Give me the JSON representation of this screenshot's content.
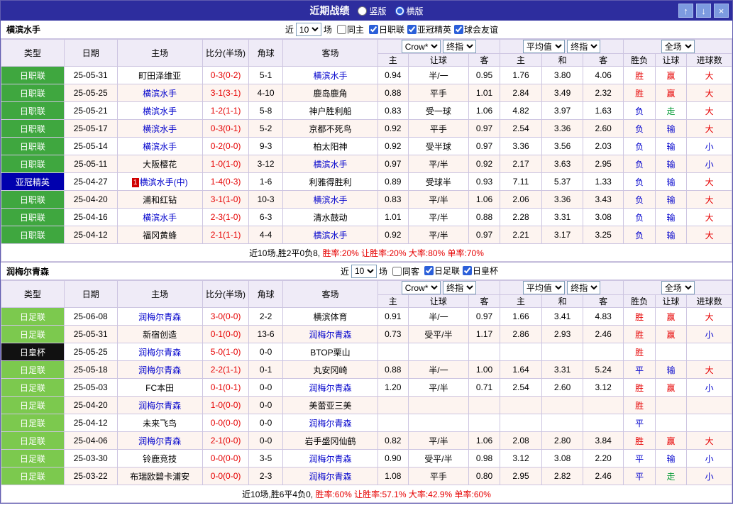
{
  "titlebar": {
    "title": "近期战绩",
    "vertical_label": "竖版",
    "horizontal_label": "横版",
    "icons": {
      "up": "↑",
      "down": "↓",
      "close": "×"
    }
  },
  "colors": {
    "titlebar_bg": "#2d2d9e",
    "header_bg": "#efebf7",
    "league_green": "#3fa73f",
    "league_lightgreen": "#7cc94e",
    "league_blue": "#0000ae",
    "league_black": "#111111",
    "win_red": "#e60000",
    "lose_blue": "#0000cc",
    "push_green": "#009933"
  },
  "sections": [
    {
      "team": "横滨水手",
      "filter": {
        "near_label": "近",
        "count": "10",
        "games_label": "场",
        "same": {
          "label": "同主",
          "checked": false
        },
        "leagues": [
          {
            "label": "日职联",
            "checked": true
          },
          {
            "label": "亚冠精英",
            "checked": true
          },
          {
            "label": "球会友谊",
            "checked": true
          }
        ]
      },
      "header": {
        "cols": [
          "类型",
          "日期",
          "主场",
          "比分(半场)",
          "角球",
          "客场"
        ],
        "selects": [
          "Crow*",
          "终指",
          "平均值",
          "终指",
          "全场"
        ],
        "sub": [
          "主",
          "让球",
          "客",
          "主",
          "和",
          "客",
          "胜负",
          "让球",
          "进球数"
        ]
      },
      "rows": [
        {
          "league": "日职联",
          "lg": "green",
          "date": "25-05-31",
          "badge": "",
          "home": "町田泽维亚",
          "home_link": false,
          "score": "0-3(0-2)",
          "corner": "5-1",
          "away": "横滨水手",
          "away_link": true,
          "odds": [
            "0.94",
            "半/一",
            "0.95"
          ],
          "euro": [
            "1.76",
            "3.80",
            "4.06"
          ],
          "result": [
            "胜",
            "r"
          ],
          "handicap_result": [
            "赢",
            "r"
          ],
          "goal_result": [
            "大",
            "r"
          ]
        },
        {
          "league": "日职联",
          "lg": "green",
          "date": "25-05-25",
          "badge": "",
          "home": "横滨水手",
          "home_link": true,
          "score": "3-1(3-1)",
          "corner": "4-10",
          "away": "鹿岛鹿角",
          "away_link": false,
          "odds": [
            "0.88",
            "平手",
            "1.01"
          ],
          "euro": [
            "2.84",
            "3.49",
            "2.32"
          ],
          "result": [
            "胜",
            "r"
          ],
          "handicap_result": [
            "赢",
            "r"
          ],
          "goal_result": [
            "大",
            "r"
          ]
        },
        {
          "league": "日职联",
          "lg": "green",
          "date": "25-05-21",
          "badge": "",
          "home": "横滨水手",
          "home_link": true,
          "score": "1-2(1-1)",
          "corner": "5-8",
          "away": "神户胜利船",
          "away_link": false,
          "odds": [
            "0.83",
            "受一球",
            "1.06"
          ],
          "euro": [
            "4.82",
            "3.97",
            "1.63"
          ],
          "result": [
            "负",
            "b"
          ],
          "handicap_result": [
            "走",
            "g"
          ],
          "goal_result": [
            "大",
            "r"
          ]
        },
        {
          "league": "日职联",
          "lg": "green",
          "date": "25-05-17",
          "badge": "",
          "home": "横滨水手",
          "home_link": true,
          "score": "0-3(0-1)",
          "corner": "5-2",
          "away": "京都不死鸟",
          "away_link": false,
          "odds": [
            "0.92",
            "平手",
            "0.97"
          ],
          "euro": [
            "2.54",
            "3.36",
            "2.60"
          ],
          "result": [
            "负",
            "b"
          ],
          "handicap_result": [
            "输",
            "b"
          ],
          "goal_result": [
            "大",
            "r"
          ]
        },
        {
          "league": "日职联",
          "lg": "green",
          "date": "25-05-14",
          "badge": "",
          "home": "横滨水手",
          "home_link": true,
          "score": "0-2(0-0)",
          "corner": "9-3",
          "away": "柏太阳神",
          "away_link": false,
          "odds": [
            "0.92",
            "受半球",
            "0.97"
          ],
          "euro": [
            "3.36",
            "3.56",
            "2.03"
          ],
          "result": [
            "负",
            "b"
          ],
          "handicap_result": [
            "输",
            "b"
          ],
          "goal_result": [
            "小",
            "b"
          ]
        },
        {
          "league": "日职联",
          "lg": "green",
          "date": "25-05-11",
          "badge": "",
          "home": "大阪樱花",
          "home_link": false,
          "score": "1-0(1-0)",
          "corner": "3-12",
          "away": "横滨水手",
          "away_link": true,
          "odds": [
            "0.97",
            "平/半",
            "0.92"
          ],
          "euro": [
            "2.17",
            "3.63",
            "2.95"
          ],
          "result": [
            "负",
            "b"
          ],
          "handicap_result": [
            "输",
            "b"
          ],
          "goal_result": [
            "小",
            "b"
          ]
        },
        {
          "league": "亚冠精英",
          "lg": "blue",
          "date": "25-04-27",
          "badge": "1",
          "home": "横滨水手(中)",
          "home_link": true,
          "score": "1-4(0-3)",
          "corner": "1-6",
          "away": "利雅得胜利",
          "away_link": false,
          "odds": [
            "0.89",
            "受球半",
            "0.93"
          ],
          "euro": [
            "7.11",
            "5.37",
            "1.33"
          ],
          "result": [
            "负",
            "b"
          ],
          "handicap_result": [
            "输",
            "b"
          ],
          "goal_result": [
            "大",
            "r"
          ]
        },
        {
          "league": "日职联",
          "lg": "green",
          "date": "25-04-20",
          "badge": "",
          "home": "浦和红钻",
          "home_link": false,
          "score": "3-1(1-0)",
          "corner": "10-3",
          "away": "横滨水手",
          "away_link": true,
          "odds": [
            "0.83",
            "平/半",
            "1.06"
          ],
          "euro": [
            "2.06",
            "3.36",
            "3.43"
          ],
          "result": [
            "负",
            "b"
          ],
          "handicap_result": [
            "输",
            "b"
          ],
          "goal_result": [
            "大",
            "r"
          ]
        },
        {
          "league": "日职联",
          "lg": "green",
          "date": "25-04-16",
          "badge": "",
          "home": "横滨水手",
          "home_link": true,
          "score": "2-3(1-0)",
          "corner": "6-3",
          "away": "清水鼓动",
          "away_link": false,
          "odds": [
            "1.01",
            "平/半",
            "0.88"
          ],
          "euro": [
            "2.28",
            "3.31",
            "3.08"
          ],
          "result": [
            "负",
            "b"
          ],
          "handicap_result": [
            "输",
            "b"
          ],
          "goal_result": [
            "大",
            "r"
          ]
        },
        {
          "league": "日职联",
          "lg": "green",
          "date": "25-04-12",
          "badge": "",
          "home": "福冈黄蜂",
          "home_link": false,
          "score": "2-1(1-1)",
          "corner": "4-4",
          "away": "横滨水手",
          "away_link": true,
          "odds": [
            "0.92",
            "平/半",
            "0.97"
          ],
          "euro": [
            "2.21",
            "3.17",
            "3.25"
          ],
          "result": [
            "负",
            "b"
          ],
          "handicap_result": [
            "输",
            "b"
          ],
          "goal_result": [
            "大",
            "r"
          ]
        }
      ],
      "summary": {
        "prefix": "近10场,胜2平0负8,",
        "rates": "胜率:20% 让胜率:20% 大率:80% 单率:70%"
      }
    },
    {
      "team": "润梅尔青森",
      "filter": {
        "near_label": "近",
        "count": "10",
        "games_label": "场",
        "same": {
          "label": "同客",
          "checked": false
        },
        "leagues": [
          {
            "label": "日足联",
            "checked": true
          },
          {
            "label": "日皇杯",
            "checked": true
          }
        ]
      },
      "header": {
        "cols": [
          "类型",
          "日期",
          "主场",
          "比分(半场)",
          "角球",
          "客场"
        ],
        "selects": [
          "Crow*",
          "终指",
          "平均值",
          "终指",
          "全场"
        ],
        "sub": [
          "主",
          "让球",
          "客",
          "主",
          "和",
          "客",
          "胜负",
          "让球",
          "进球数"
        ]
      },
      "rows": [
        {
          "league": "日足联",
          "lg": "lgreen",
          "date": "25-06-08",
          "badge": "",
          "home": "润梅尔青森",
          "home_link": true,
          "score": "3-0(0-0)",
          "corner": "2-2",
          "away": "横滨体育",
          "away_link": false,
          "odds": [
            "0.91",
            "半/一",
            "0.97"
          ],
          "euro": [
            "1.66",
            "3.41",
            "4.83"
          ],
          "result": [
            "胜",
            "r"
          ],
          "handicap_result": [
            "赢",
            "r"
          ],
          "goal_result": [
            "大",
            "r"
          ]
        },
        {
          "league": "日足联",
          "lg": "lgreen",
          "date": "25-05-31",
          "badge": "",
          "home": "新宿创造",
          "home_link": false,
          "score": "0-1(0-0)",
          "corner": "13-6",
          "away": "润梅尔青森",
          "away_link": true,
          "odds": [
            "0.73",
            "受平/半",
            "1.17"
          ],
          "euro": [
            "2.86",
            "2.93",
            "2.46"
          ],
          "result": [
            "胜",
            "r"
          ],
          "handicap_result": [
            "赢",
            "r"
          ],
          "goal_result": [
            "小",
            "b"
          ]
        },
        {
          "league": "日皇杯",
          "lg": "black",
          "date": "25-05-25",
          "badge": "",
          "home": "润梅尔青森",
          "home_link": true,
          "score": "5-0(1-0)",
          "corner": "0-0",
          "away": "BTOP栗山",
          "away_link": false,
          "odds": [
            "",
            "",
            ""
          ],
          "euro": [
            "",
            "",
            ""
          ],
          "result": [
            "胜",
            "r"
          ],
          "handicap_result": [
            "",
            ""
          ],
          "goal_result": [
            "",
            ""
          ]
        },
        {
          "league": "日足联",
          "lg": "lgreen",
          "date": "25-05-18",
          "badge": "",
          "home": "润梅尔青森",
          "home_link": true,
          "score": "2-2(1-1)",
          "corner": "0-1",
          "away": "丸安冈崎",
          "away_link": false,
          "odds": [
            "0.88",
            "半/一",
            "1.00"
          ],
          "euro": [
            "1.64",
            "3.31",
            "5.24"
          ],
          "result": [
            "平",
            "b"
          ],
          "handicap_result": [
            "输",
            "b"
          ],
          "goal_result": [
            "大",
            "r"
          ]
        },
        {
          "league": "日足联",
          "lg": "lgreen",
          "date": "25-05-03",
          "badge": "",
          "home": "FC本田",
          "home_link": false,
          "score": "0-1(0-1)",
          "corner": "0-0",
          "away": "润梅尔青森",
          "away_link": true,
          "odds": [
            "1.20",
            "平/半",
            "0.71"
          ],
          "euro": [
            "2.54",
            "2.60",
            "3.12"
          ],
          "result": [
            "胜",
            "r"
          ],
          "handicap_result": [
            "赢",
            "r"
          ],
          "goal_result": [
            "小",
            "b"
          ]
        },
        {
          "league": "日足联",
          "lg": "lgreen",
          "date": "25-04-20",
          "badge": "",
          "home": "润梅尔青森",
          "home_link": true,
          "score": "1-0(0-0)",
          "corner": "0-0",
          "away": "美蕾亚三美",
          "away_link": false,
          "odds": [
            "",
            "",
            ""
          ],
          "euro": [
            "",
            "",
            ""
          ],
          "result": [
            "胜",
            "r"
          ],
          "handicap_result": [
            "",
            ""
          ],
          "goal_result": [
            "",
            ""
          ]
        },
        {
          "league": "日足联",
          "lg": "lgreen",
          "date": "25-04-12",
          "badge": "",
          "home": "未来飞鸟",
          "home_link": false,
          "score": "0-0(0-0)",
          "corner": "0-0",
          "away": "润梅尔青森",
          "away_link": true,
          "odds": [
            "",
            "",
            ""
          ],
          "euro": [
            "",
            "",
            ""
          ],
          "result": [
            "平",
            "b"
          ],
          "handicap_result": [
            "",
            ""
          ],
          "goal_result": [
            "",
            ""
          ]
        },
        {
          "league": "日足联",
          "lg": "lgreen",
          "date": "25-04-06",
          "badge": "",
          "home": "润梅尔青森",
          "home_link": true,
          "score": "2-1(0-0)",
          "corner": "0-0",
          "away": "岩手盛冈仙鹤",
          "away_link": false,
          "odds": [
            "0.82",
            "平/半",
            "1.06"
          ],
          "euro": [
            "2.08",
            "2.80",
            "3.84"
          ],
          "result": [
            "胜",
            "r"
          ],
          "handicap_result": [
            "赢",
            "r"
          ],
          "goal_result": [
            "大",
            "r"
          ]
        },
        {
          "league": "日足联",
          "lg": "lgreen",
          "date": "25-03-30",
          "badge": "",
          "home": "铃鹿竞技",
          "home_link": false,
          "score": "0-0(0-0)",
          "corner": "3-5",
          "away": "润梅尔青森",
          "away_link": true,
          "odds": [
            "0.90",
            "受平/半",
            "0.98"
          ],
          "euro": [
            "3.12",
            "3.08",
            "2.20"
          ],
          "result": [
            "平",
            "b"
          ],
          "handicap_result": [
            "输",
            "b"
          ],
          "goal_result": [
            "小",
            "b"
          ]
        },
        {
          "league": "日足联",
          "lg": "lgreen",
          "date": "25-03-22",
          "badge": "",
          "home": "布瑞欧碧卡浦安",
          "home_link": false,
          "score": "0-0(0-0)",
          "corner": "2-3",
          "away": "润梅尔青森",
          "away_link": true,
          "odds": [
            "1.08",
            "平手",
            "0.80"
          ],
          "euro": [
            "2.95",
            "2.82",
            "2.46"
          ],
          "result": [
            "平",
            "b"
          ],
          "handicap_result": [
            "走",
            "g"
          ],
          "goal_result": [
            "小",
            "b"
          ]
        }
      ],
      "summary": {
        "prefix": "近10场,胜6平4负0,",
        "rates": "胜率:60% 让胜率:57.1% 大率:42.9% 单率:60%"
      }
    }
  ]
}
